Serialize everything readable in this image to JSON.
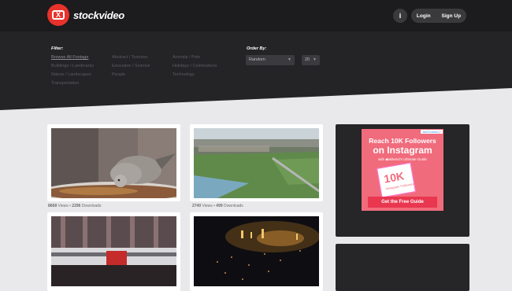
{
  "brand": {
    "name": "stockvideo",
    "badge_letter": "X"
  },
  "header": {
    "info_icon": "i",
    "login_label": "Login",
    "signup_label": "Sign Up"
  },
  "filter": {
    "title": "Filter:",
    "options": [
      "Browse All Footage",
      "Abstract / Textures",
      "Animals / Pets",
      "Buildings / Landmarks",
      "Education / Science",
      "Holidays / Celebrations",
      "Nature / Landscapes",
      "People",
      "Technology",
      "Transportation"
    ],
    "active_index": 0
  },
  "order": {
    "title": "Order By:",
    "sort_value": "Random",
    "per_page_value": "20"
  },
  "videos": [
    {
      "views": "8668",
      "downloads": "2296",
      "views_label": "Views",
      "downloads_label": "Downloads"
    },
    {
      "views": "2740",
      "downloads": "499",
      "views_label": "Views",
      "downloads_label": "Downloads"
    }
  ],
  "ad": {
    "choices_label": "AdChoices ▷",
    "line1": "Reach 10K Followers",
    "line2": "on Instagram",
    "sub": "with ◆tailwind's Ultimate Guide",
    "card_big": "10K",
    "card_small": "Instagram Followers",
    "cta": "Get the Free Guide"
  },
  "colors": {
    "brand_red": "#e8322c",
    "topbar": "#1c1b1d",
    "filterband": "#242326",
    "ad_pink": "#f06b7c"
  }
}
